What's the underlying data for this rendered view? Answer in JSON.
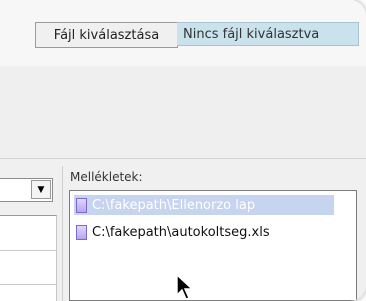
{
  "file_input": {
    "button_label": "Fájl kiválasztása",
    "status_text": "Nincs fájl kiválasztva"
  },
  "attachments": {
    "label": "Mellékletek:",
    "items": [
      {
        "path": "C:\\fakepath\\Ellenorzo lap",
        "selected": true,
        "icon": "file-icon"
      },
      {
        "path": "C:\\fakepath\\autokoltseg.xls",
        "selected": false,
        "icon": "file-icon"
      }
    ]
  },
  "left_select": {
    "arrow_icon": "dropdown-arrow-icon"
  },
  "colors": {
    "selected_row": "#c6d4f0",
    "status_bg": "#c9e2ec"
  }
}
